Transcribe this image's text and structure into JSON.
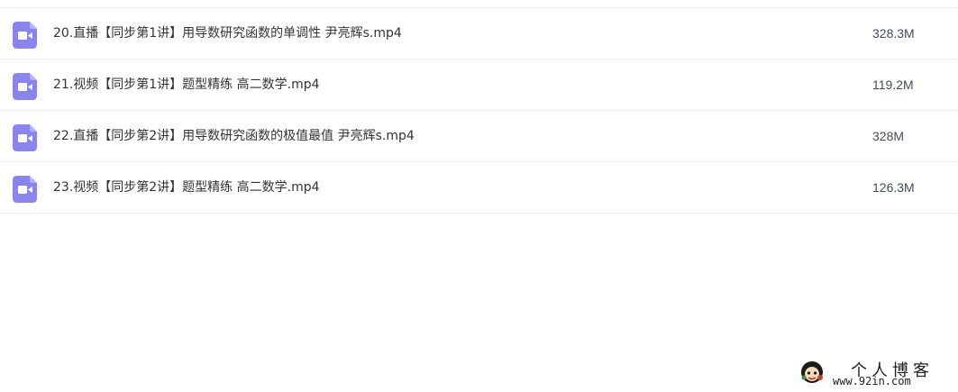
{
  "files": [
    {
      "name": "20.直播【同步第1讲】用导数研究函数的单调性 尹亮辉s.mp4",
      "size": "328.3M",
      "icon": "video-file-icon"
    },
    {
      "name": "21.视频【同步第1讲】题型精练 高二数学.mp4",
      "size": "119.2M",
      "icon": "video-file-icon"
    },
    {
      "name": "22.直播【同步第2讲】用导数研究函数的极值最值 尹亮辉s.mp4",
      "size": "328M",
      "icon": "video-file-icon"
    },
    {
      "name": "23.视频【同步第2讲】题型精练 高二数学.mp4",
      "size": "126.3M",
      "icon": "video-file-icon"
    }
  ],
  "watermark": {
    "title": "个人博客",
    "url": "www.92in.com"
  },
  "colors": {
    "icon_purple": "#8a84f0",
    "row_divider": "#eef0f3",
    "text": "#333333"
  }
}
